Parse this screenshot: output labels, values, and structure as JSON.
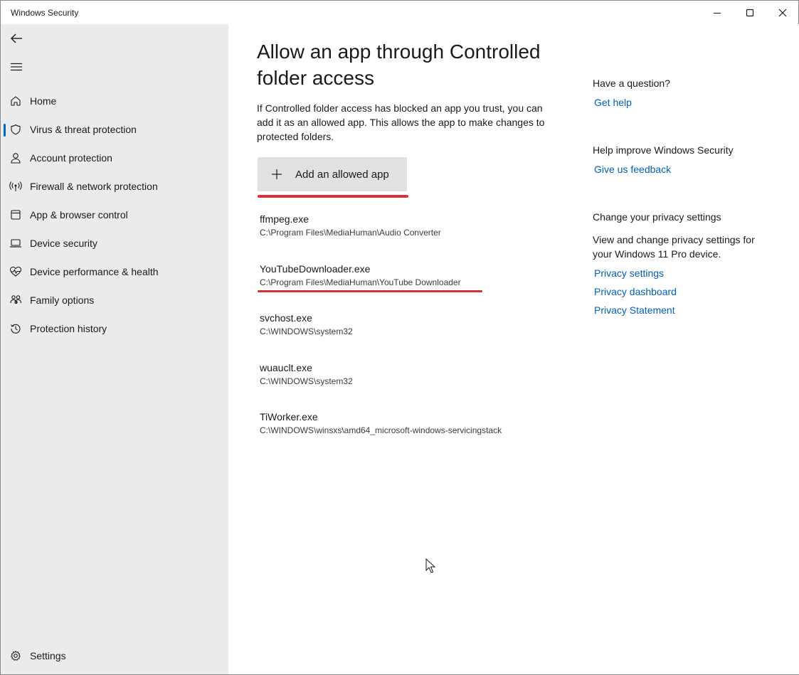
{
  "window": {
    "title": "Windows Security"
  },
  "sidebar": {
    "items": [
      {
        "label": "Home",
        "icon": "home-icon"
      },
      {
        "label": "Virus & threat protection",
        "icon": "shield-icon",
        "selected": true
      },
      {
        "label": "Account protection",
        "icon": "person-icon"
      },
      {
        "label": "Firewall & network protection",
        "icon": "antenna-icon"
      },
      {
        "label": "App & browser control",
        "icon": "app-window-icon"
      },
      {
        "label": "Device security",
        "icon": "laptop-icon"
      },
      {
        "label": "Device performance & health",
        "icon": "heart-pulse-icon"
      },
      {
        "label": "Family options",
        "icon": "family-icon"
      },
      {
        "label": "Protection history",
        "icon": "history-icon"
      }
    ],
    "settings_label": "Settings"
  },
  "main": {
    "title": "Allow an app through Controlled folder access",
    "description": "If Controlled folder access has blocked an app you trust, you can add it as an allowed app. This allows the app to make changes to protected folders.",
    "add_button_label": "Add an allowed app",
    "apps": [
      {
        "name": "ffmpeg.exe",
        "path": "C:\\Program Files\\MediaHuman\\Audio Converter"
      },
      {
        "name": "YouTubeDownloader.exe",
        "path": "C:\\Program Files\\MediaHuman\\YouTube Downloader"
      },
      {
        "name": "svchost.exe",
        "path": "C:\\WINDOWS\\system32"
      },
      {
        "name": "wuauclt.exe",
        "path": "C:\\WINDOWS\\system32"
      },
      {
        "name": "TiWorker.exe",
        "path": "C:\\WINDOWS\\winsxs\\amd64_microsoft-windows-servicingstack"
      }
    ]
  },
  "right_pane": {
    "question_heading": "Have a question?",
    "get_help_link": "Get help",
    "improve_heading": "Help improve Windows Security",
    "feedback_link": "Give us feedback",
    "privacy_heading": "Change your privacy settings",
    "privacy_text": "View and change privacy settings for your Windows 11 Pro device.",
    "privacy_settings_link": "Privacy settings",
    "privacy_dashboard_link": "Privacy dashboard",
    "privacy_statement_link": "Privacy Statement"
  },
  "colors": {
    "accent": "#0067c0",
    "link": "#005fb8",
    "annotation_red": "#d13438",
    "sidebar_bg": "#ebebeb"
  }
}
